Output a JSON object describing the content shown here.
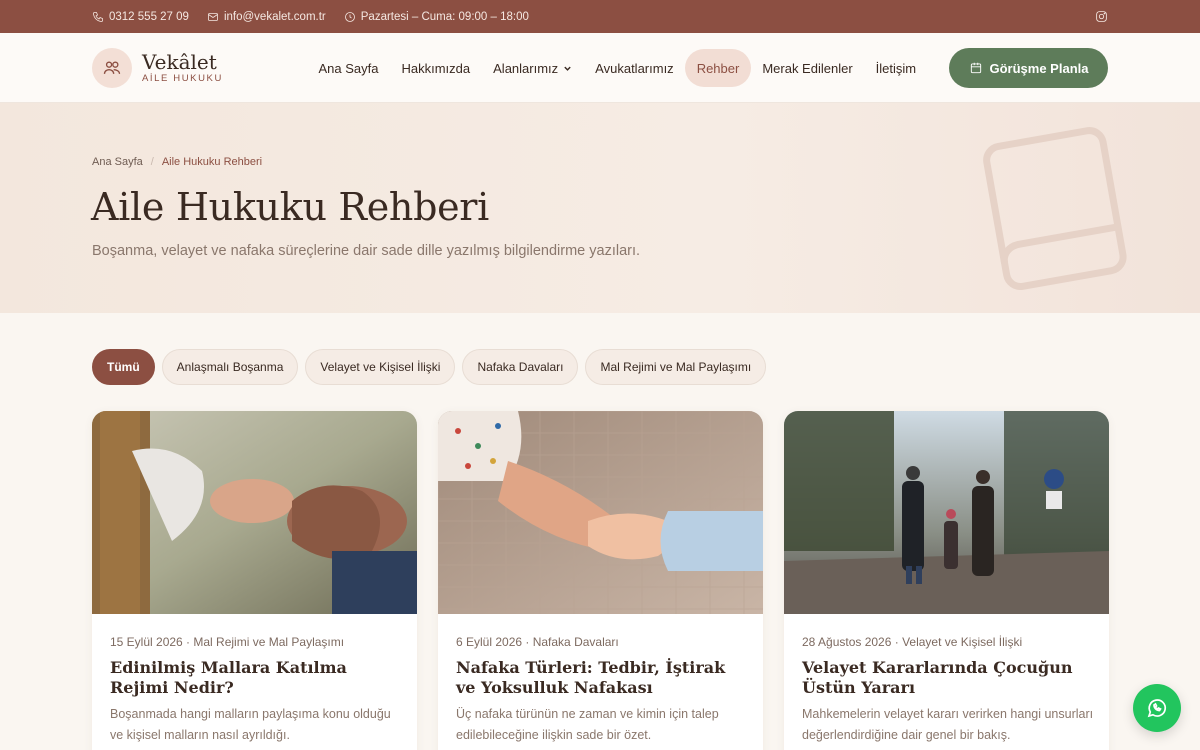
{
  "topbar": {
    "phone": "0312 555 27 09",
    "email": "info@vekalet.com.tr",
    "hours": "Pazartesi – Cuma: 09:00 – 18:00",
    "social_icon": "instagram-icon"
  },
  "brand": {
    "name": "Vekâlet",
    "tagline": "AİLE HUKUKU",
    "icon": "users-icon"
  },
  "nav": {
    "items": [
      {
        "label": "Ana Sayfa"
      },
      {
        "label": "Hakkımızda"
      },
      {
        "label": "Alanlarımız"
      },
      {
        "label": "Avukatlarımız"
      },
      {
        "label": "Rehber"
      },
      {
        "label": "Merak Edilenler"
      },
      {
        "label": "İletişim"
      }
    ],
    "active": "Rehber",
    "cta_label": "Görüşme Planla"
  },
  "breadcrumb": {
    "home": "Ana Sayfa",
    "current": "Aile Hukuku Rehberi"
  },
  "hero": {
    "title": "Aile Hukuku Rehberi",
    "lead": "Boşanma, velayet ve nafaka süreçlerine dair sade dille yazılmış bilgilendirme yazıları."
  },
  "filters": {
    "items": [
      "Tümü",
      "Anlaşmalı Boşanma",
      "Velayet ve Kişisel İlişki",
      "Nafaka Davaları",
      "Mal Rejimi ve Mal Paylaşımı"
    ],
    "active": "Tümü"
  },
  "articles": [
    {
      "meta": "15 Eylül 2026 · Mal Rejimi ve Mal Paylaşımı",
      "title": "Edinilmiş Mallara Katılma Rejimi Nedir?",
      "excerpt": "Boşanmada hangi malların paylaşıma konu olduğu ve kişisel malların nasıl ayrıldığı."
    },
    {
      "meta": "6 Eylül 2026 · Nafaka Davaları",
      "title": "Nafaka Türleri: Tedbir, İştirak ve Yoksulluk Nafakası",
      "excerpt": "Üç nafaka türünün ne zaman ve kimin için talep edilebileceğine ilişkin sade bir özet."
    },
    {
      "meta": "28 Ağustos 2026 · Velayet ve Kişisel İlişki",
      "title": "Velayet Kararlarında Çocuğun Üstün Yararı",
      "excerpt": "Mahkemelerin velayet kararı verirken hangi unsurları değerlendirdiğine dair genel bir bakış."
    }
  ],
  "colors": {
    "brand": "#8c4f42",
    "accent_green": "#5e7c5a",
    "whatsapp": "#22c55e"
  }
}
